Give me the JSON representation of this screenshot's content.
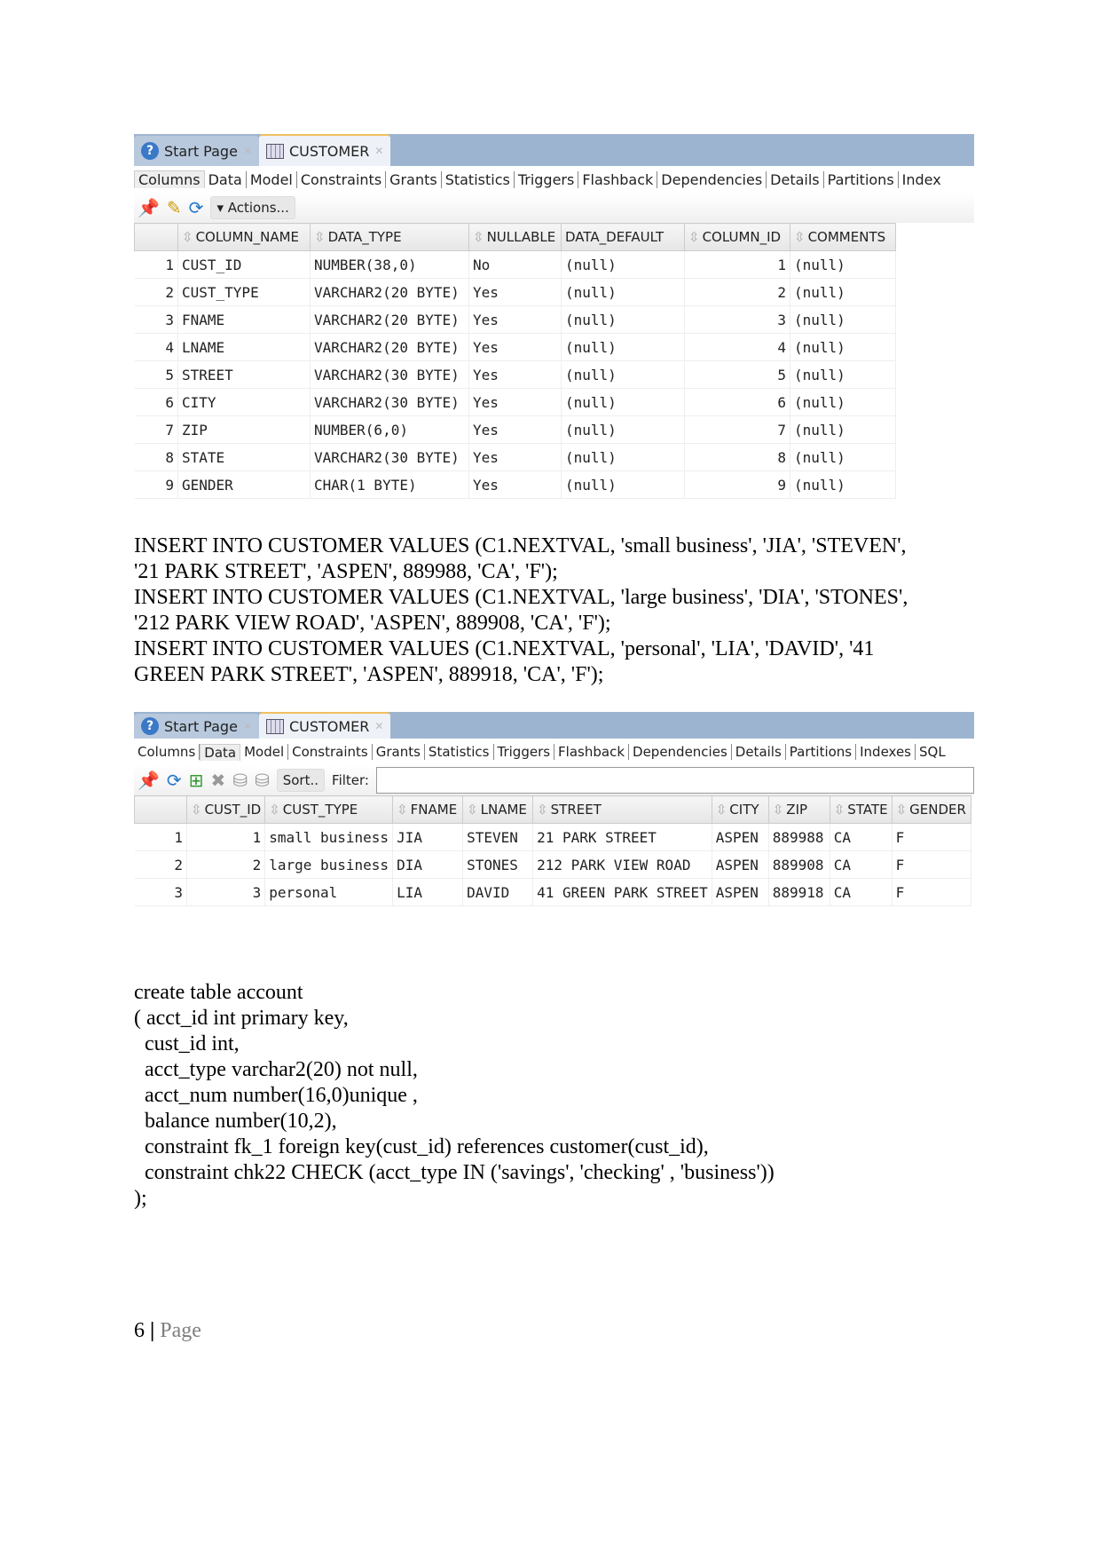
{
  "shot1": {
    "tabs": [
      {
        "label": "Start Page",
        "icon": "help-icon"
      },
      {
        "label": "CUSTOMER",
        "icon": "table-icon"
      }
    ],
    "subtabs": [
      "Columns",
      "Data",
      "Model",
      "Constraints",
      "Grants",
      "Statistics",
      "Triggers",
      "Flashback",
      "Dependencies",
      "Details",
      "Partitions",
      "Index"
    ],
    "selected_subtab": "Columns",
    "actions_label": "▾ Actions...",
    "headers": [
      "COLUMN_NAME",
      "DATA_TYPE",
      "NULLABLE",
      "DATA_DEFAULT",
      "COLUMN_ID",
      "COMMENTS"
    ],
    "rows": [
      [
        "1",
        "CUST_ID",
        "NUMBER(38,0)",
        "No",
        "(null)",
        "1",
        "(null)"
      ],
      [
        "2",
        "CUST_TYPE",
        "VARCHAR2(20 BYTE)",
        "Yes",
        "(null)",
        "2",
        "(null)"
      ],
      [
        "3",
        "FNAME",
        "VARCHAR2(20 BYTE)",
        "Yes",
        "(null)",
        "3",
        "(null)"
      ],
      [
        "4",
        "LNAME",
        "VARCHAR2(20 BYTE)",
        "Yes",
        "(null)",
        "4",
        "(null)"
      ],
      [
        "5",
        "STREET",
        "VARCHAR2(30 BYTE)",
        "Yes",
        "(null)",
        "5",
        "(null)"
      ],
      [
        "6",
        "CITY",
        "VARCHAR2(30 BYTE)",
        "Yes",
        "(null)",
        "6",
        "(null)"
      ],
      [
        "7",
        "ZIP",
        "NUMBER(6,0)",
        "Yes",
        "(null)",
        "7",
        "(null)"
      ],
      [
        "8",
        "STATE",
        "VARCHAR2(30 BYTE)",
        "Yes",
        "(null)",
        "8",
        "(null)"
      ],
      [
        "9",
        "GENDER",
        "CHAR(1 BYTE)",
        "Yes",
        "(null)",
        "9",
        "(null)"
      ]
    ]
  },
  "inserts": "INSERT INTO CUSTOMER VALUES (C1.NEXTVAL, 'small business', 'JIA', 'STEVEN',\n'21 PARK STREET', 'ASPEN', 889988, 'CA', 'F');\nINSERT INTO CUSTOMER VALUES (C1.NEXTVAL, 'large business', 'DIA', 'STONES',\n'212 PARK VIEW ROAD', 'ASPEN', 889908, 'CA', 'F');\nINSERT INTO CUSTOMER VALUES (C1.NEXTVAL, 'personal', 'LIA', 'DAVID', '41\nGREEN PARK STREET', 'ASPEN', 889918, 'CA', 'F');",
  "shot2": {
    "tabs": [
      {
        "label": "Start Page",
        "icon": "help-icon"
      },
      {
        "label": "CUSTOMER",
        "icon": "table-icon"
      }
    ],
    "subtabs": [
      "Columns",
      "Data",
      "Model",
      "Constraints",
      "Grants",
      "Statistics",
      "Triggers",
      "Flashback",
      "Dependencies",
      "Details",
      "Partitions",
      "Indexes",
      "SQL"
    ],
    "selected_subtab": "Data",
    "sort_label": "Sort..",
    "filter_label": "Filter:",
    "filter_value": "",
    "headers": [
      "CUST_ID",
      "CUST_TYPE",
      "FNAME",
      "LNAME",
      "STREET",
      "CITY",
      "ZIP",
      "STATE",
      "GENDER"
    ],
    "rows": [
      [
        "1",
        "1",
        "small business",
        "JIA",
        "STEVEN",
        "21 PARK STREET",
        "ASPEN",
        "889988",
        "CA",
        "F"
      ],
      [
        "2",
        "2",
        "large business",
        "DIA",
        "STONES",
        "212 PARK VIEW ROAD",
        "ASPEN",
        "889908",
        "CA",
        "F"
      ],
      [
        "3",
        "3",
        "personal",
        "LIA",
        "DAVID",
        "41  GREEN PARK STREET",
        "ASPEN",
        "889918",
        "CA",
        "F"
      ]
    ]
  },
  "create_sql": "create table account\n( acct_id int primary key,\n  cust_id int,\n  acct_type varchar2(20) not null,\n  acct_num number(16,0)unique ,\n  balance number(10,2),\n  constraint fk_1 foreign key(cust_id) references customer(cust_id),\n  constraint chk22 CHECK (acct_type IN ('savings', 'checking' , 'business'))\n);",
  "footer": {
    "page_number": "6",
    "separator": " | ",
    "page_label": "Page"
  }
}
